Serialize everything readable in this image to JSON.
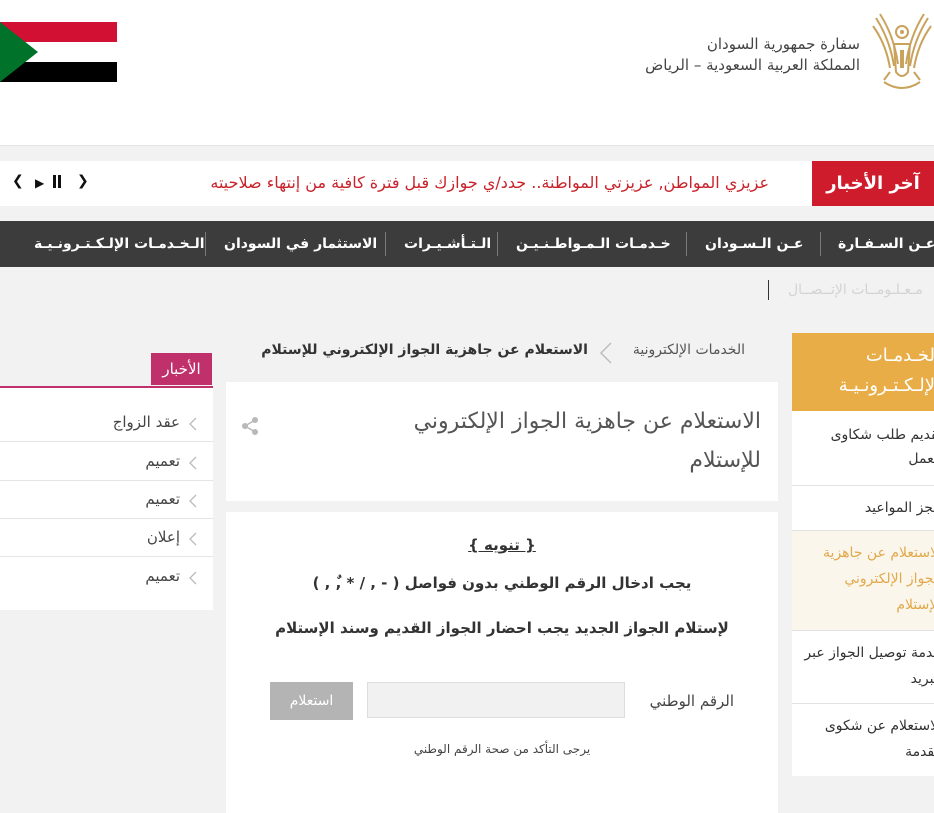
{
  "header": {
    "embassy_name": "سفارة جمهورية السودان",
    "embassy_location": "المملكة العربية السعودية – الرياض"
  },
  "flag_colors": {
    "red": "#d21034",
    "white": "#ffffff",
    "black": "#000000",
    "green": "#007229"
  },
  "ticker": {
    "label": "آخر الأخبار",
    "text": "عزيزي المواطن, عزيزتي المواطنة.. جدد/ي جوازك قبل فترة كافية من إنتهاء صلاحيته",
    "prev_icon": "chevron-left-icon",
    "next_icon": "chevron-right-icon",
    "play_icon": "play-icon",
    "pause_icon": "pause-icon"
  },
  "nav": {
    "items": [
      "عـن السـفـارة",
      "عـن الـسـودان",
      "خـدمـات الـمـواطـنـيـن",
      "الـتـأشـيـرات",
      "الاستثمار في السودان",
      "الـخـدمـات الإلـكـتـرونـيـة"
    ],
    "sub_item": "مـعـلـومــات الإتــصــال"
  },
  "sidebar": {
    "heading_lines": [
      "الخـدمـات",
      "الإلـكـتـرونـيـة"
    ],
    "items": [
      {
        "lines": [
          "تقديم طلب شكاوى",
          "العمل"
        ]
      },
      {
        "lines": [
          "حجز المواعيد"
        ]
      },
      {
        "lines": [
          "الاستعلام عن جاهزية",
          "الجواز الإلكتروني",
          "للإستلام"
        ],
        "active": true
      },
      {
        "lines": [
          "خدمة توصيل الجواز عبر",
          "البريد"
        ]
      },
      {
        "lines": [
          "الاستعلام عن شكوى",
          "مقدمة"
        ]
      }
    ]
  },
  "breadcrumb": {
    "home": "الخدمات الإلكترونية",
    "current": "الاستعلام عن جاهزية الجواز الإلكتروني للإستلام"
  },
  "page": {
    "title_lines": [
      "الاستعلام عن جاهزية الجواز الإلكتروني",
      "للإستلام"
    ],
    "share_icon": "share-icon"
  },
  "notice": {
    "heading": "{ تنويه }",
    "line1": "يجب ادخال الرقم الوطني بدون فواصل ( - , / * ,ٌ , )",
    "line2": "لإستلام الجواز الجديد يجب احضار الجواز القديم  وسند الإستلام"
  },
  "form": {
    "national_id_label": "الرقم الوطني",
    "national_id_value": "",
    "query_button": "استعلام",
    "hint": "يرجى التأكد من صحة الرقم الوطني"
  },
  "news": {
    "label": "الأخبار",
    "items": [
      "عقد الزواج",
      "تعميم",
      "تعميم",
      "إعلان",
      "تعميم"
    ]
  }
}
